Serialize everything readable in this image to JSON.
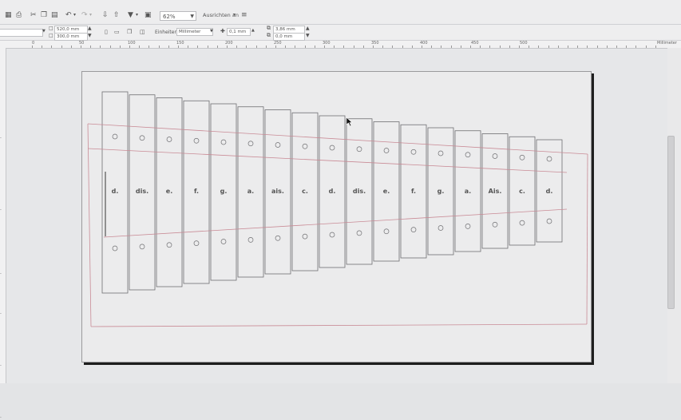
{
  "toolbar": {
    "zoom_value": "62%",
    "snap_label": "Ausrichten an"
  },
  "propbar": {
    "width_value": "520,0 mm",
    "height_value": "300,0 mm",
    "units_label": "Einheiten:",
    "units_value": "Millimeter",
    "nudge_value": "0,1 mm",
    "dup_x_value": "3,86 mm",
    "dup_y_value": "0,0 mm"
  },
  "ruler": {
    "unit_label": "Millimeter",
    "labels": [
      "0",
      "50",
      "100",
      "150",
      "200",
      "250",
      "300",
      "350",
      "400",
      "450",
      "500"
    ]
  },
  "bars": [
    {
      "note": "d."
    },
    {
      "note": "dis."
    },
    {
      "note": "e."
    },
    {
      "note": "f."
    },
    {
      "note": "g."
    },
    {
      "note": "a."
    },
    {
      "note": "ais."
    },
    {
      "note": "c."
    },
    {
      "note": "d."
    },
    {
      "note": "dis."
    },
    {
      "note": "e."
    },
    {
      "note": "f."
    },
    {
      "note": "g."
    },
    {
      "note": "a."
    },
    {
      "note": "Ais."
    },
    {
      "note": "c."
    },
    {
      "note": "d."
    }
  ],
  "colors": {
    "guide_line": "#c98b96",
    "bar_stroke": "#6f6f72",
    "page_shadow": "#1e1e1e"
  },
  "icons": [
    "save-icon",
    "print-icon",
    "cut-icon",
    "copy-icon",
    "paste-icon",
    "undo-icon",
    "redo-icon",
    "import-icon",
    "export-icon",
    "publish-icon",
    "fullscreen-icon",
    "snap-icon",
    "nudge-icon",
    "duplicate-distance-icon",
    "cursor-icon"
  ]
}
